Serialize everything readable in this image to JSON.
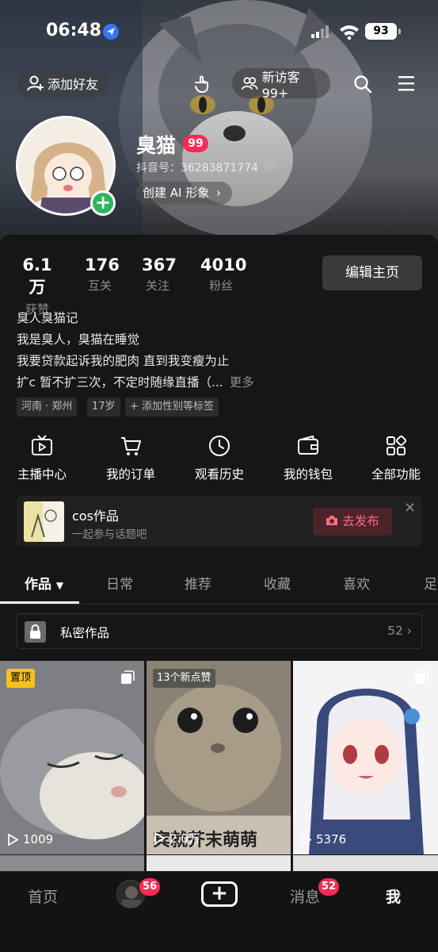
{
  "status_bar": {
    "time": "06:48",
    "battery": "93"
  },
  "header": {
    "add_friend": "添加好友",
    "visitors": "新访客 99+"
  },
  "profile": {
    "name": "臭猫",
    "name_badge": "99",
    "douyin_id": "抖音号：36283871774",
    "ai_button": "创建 AI 形象"
  },
  "stats": [
    {
      "value": "6.1万",
      "label": "获赞"
    },
    {
      "value": "176",
      "label": "互关"
    },
    {
      "value": "367",
      "label": "关注"
    },
    {
      "value": "4010",
      "label": "粉丝"
    }
  ],
  "edit_profile": "编辑主页",
  "bio": {
    "lines": [
      "臭人臭猫记",
      "我是臭人，臭猫在睡觉",
      "我要贷款起诉我的肥肉 直到我变瘦为止",
      "扩c 暂不扩三次，不定时随缘直播（..."
    ],
    "more": "更多"
  },
  "tags": [
    "河南 · 郑州",
    "17岁",
    "+ 添加性别等标签"
  ],
  "functions": [
    {
      "label": "主播中心",
      "icon": "tv-icon"
    },
    {
      "label": "我的订单",
      "icon": "cart-icon"
    },
    {
      "label": "观看历史",
      "icon": "clock-icon"
    },
    {
      "label": "我的钱包",
      "icon": "wallet-icon"
    },
    {
      "label": "全部功能",
      "icon": "grid-icon"
    }
  ],
  "cos_card": {
    "title": "cos作品",
    "subtitle": "一起参与话题吧",
    "button": "去发布"
  },
  "tabs": [
    "作品",
    "日常",
    "推荐",
    "收藏",
    "喜欢",
    "足"
  ],
  "private_works": {
    "label": "私密作品",
    "count": "52"
  },
  "grid": [
    {
      "badge": "置顶",
      "plays": "1009",
      "overlay": ""
    },
    {
      "badge": "13个新点赞",
      "plays": "2.0万",
      "overlay": "宾就芥末萌萌"
    },
    {
      "badge": "",
      "plays": "5376",
      "overlay": ""
    }
  ],
  "bottom_nav": {
    "home": "首页",
    "friends_badge": "56",
    "messages": "消息",
    "messages_badge": "52",
    "me": "我"
  },
  "colors": {
    "accent": "#fe2c55",
    "pin": "#f6c21c",
    "online": "#2fb55c",
    "background": "#161616"
  }
}
